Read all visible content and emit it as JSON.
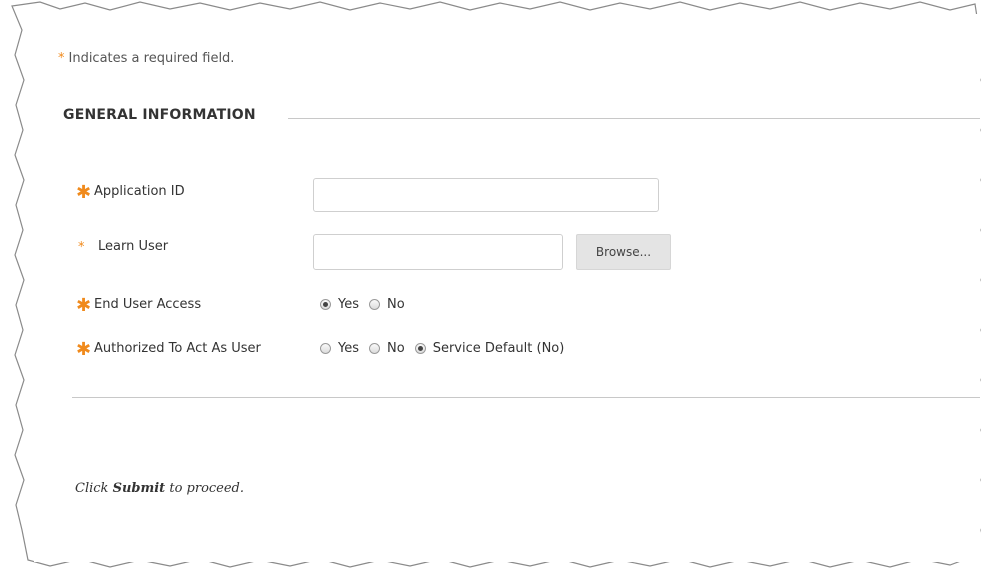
{
  "required_note": {
    "star": "*",
    "text": "Indicates a required field."
  },
  "section": {
    "title": "GENERAL INFORMATION"
  },
  "fields": {
    "application_id": {
      "label": "Application ID",
      "value": ""
    },
    "learn_user": {
      "label": "Learn User",
      "value": "",
      "browse_label": "Browse..."
    },
    "end_user_access": {
      "label": "End User Access",
      "options": [
        "Yes",
        "No"
      ],
      "selected": "Yes"
    },
    "authorized_to_act": {
      "label": "Authorized To Act As User",
      "options": [
        "Yes",
        "No",
        "Service Default (No)"
      ],
      "selected": "Service Default (No)"
    }
  },
  "footer": {
    "prefix": "Click",
    "submit_word": "Submit",
    "suffix": "to proceed."
  },
  "colors": {
    "required_star": "#f08a1c",
    "rule": "#c8c8c8"
  }
}
